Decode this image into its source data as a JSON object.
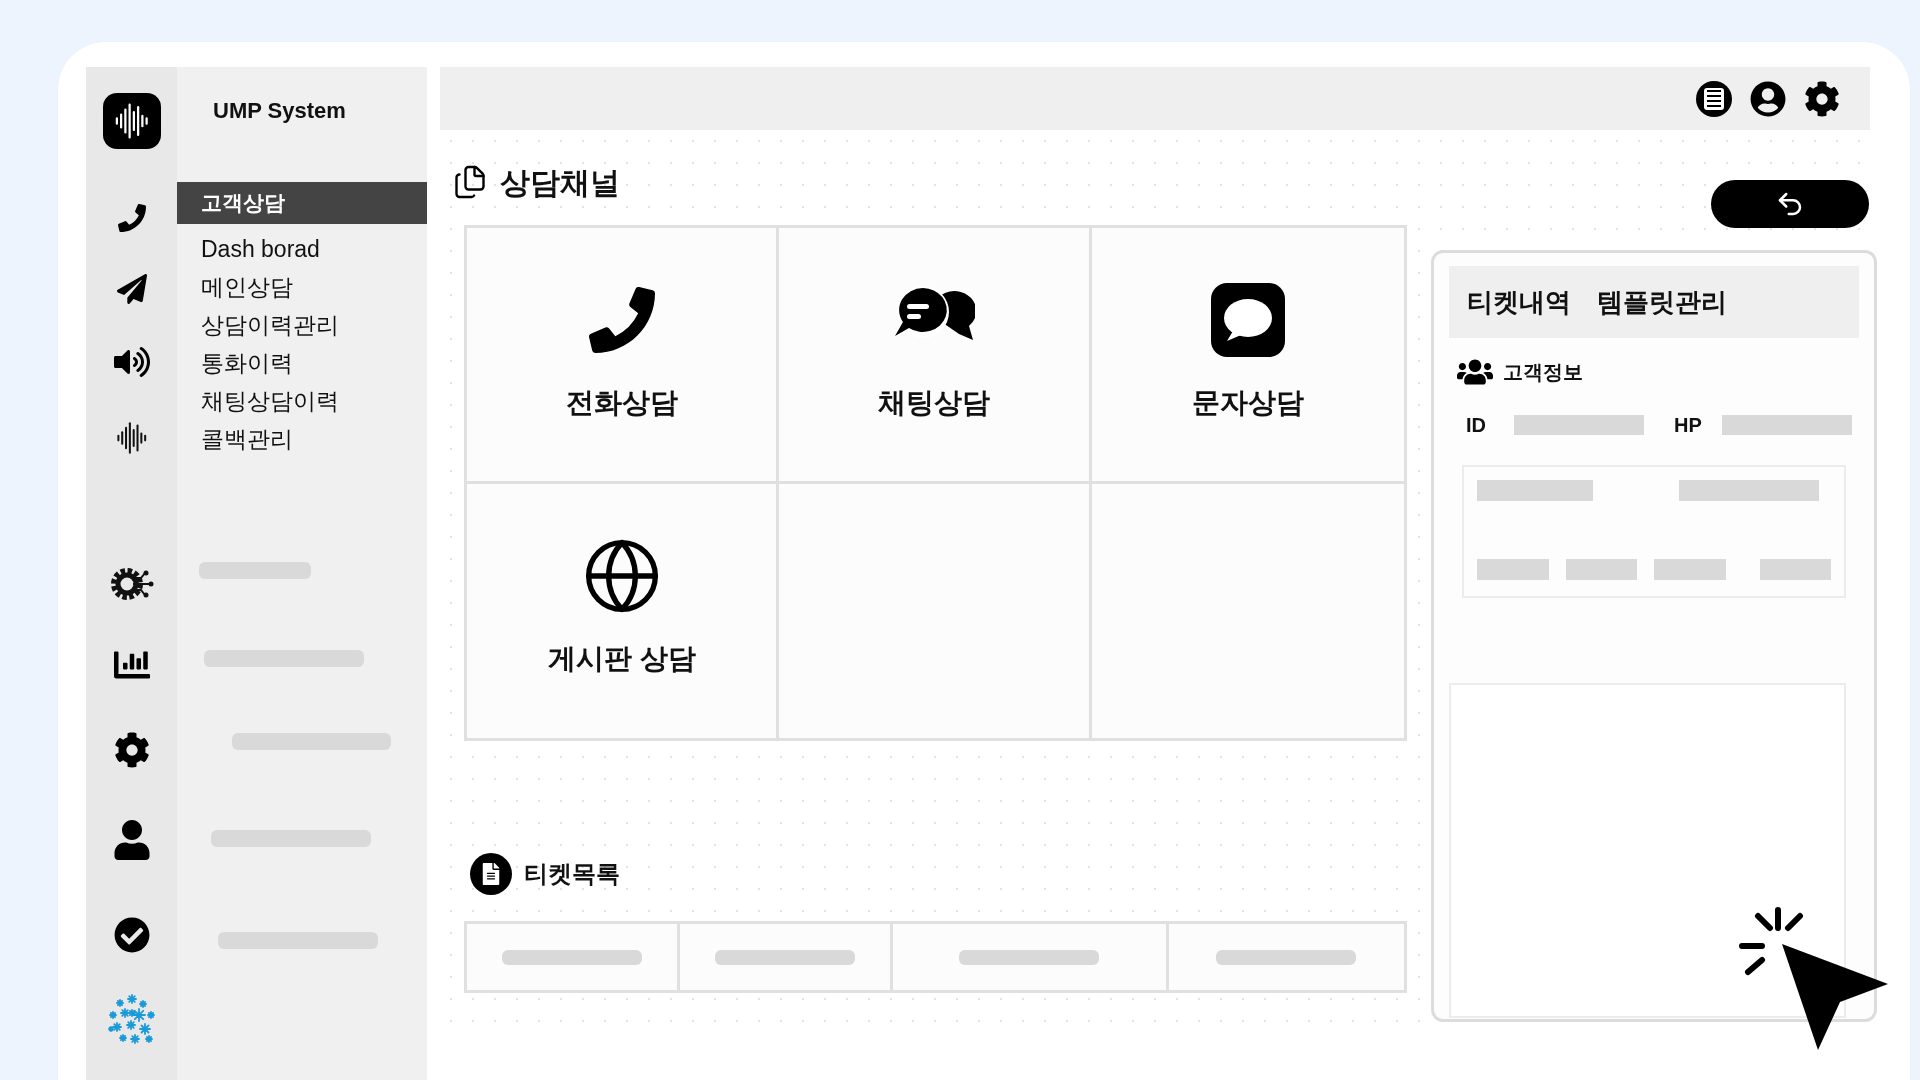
{
  "app": {
    "title": "UMP System"
  },
  "nav": [
    {
      "label": "고객상담",
      "selected": true
    },
    {
      "label": "Dash borad",
      "selected": false
    },
    {
      "label": "메인상담",
      "selected": false
    },
    {
      "label": "상담이력관리",
      "selected": false
    },
    {
      "label": "통화이력",
      "selected": false
    },
    {
      "label": "채팅상담이력",
      "selected": false
    },
    {
      "label": "콜백관리",
      "selected": false
    }
  ],
  "channels": {
    "title": "상담채널",
    "items": [
      {
        "kind": "phone",
        "label": "전화상담"
      },
      {
        "kind": "chat",
        "label": "채팅상담"
      },
      {
        "kind": "sms",
        "label": "문자상담"
      },
      {
        "kind": "globe",
        "label": "게시판 상담"
      }
    ]
  },
  "ticket_list": {
    "title": "티켓목록"
  },
  "side_panel": {
    "tabs": [
      "티켓내역",
      "템플릿관리"
    ],
    "customer": {
      "title": "고객정보",
      "fields": [
        "ID",
        "HP"
      ]
    }
  }
}
